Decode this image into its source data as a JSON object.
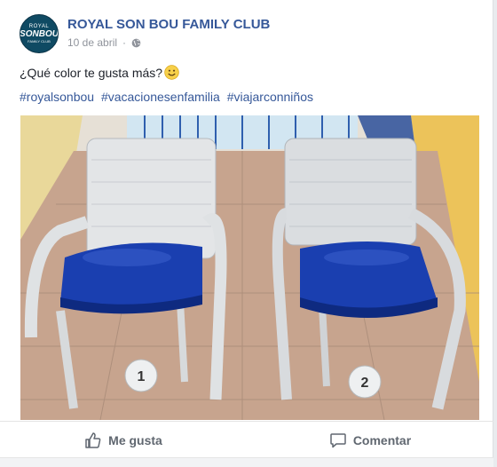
{
  "post": {
    "page_name": "ROYAL SON BOU FAMILY CLUB",
    "avatar_text": {
      "top": "ROYAL",
      "middle": "SONBOU",
      "bottom": "FAMILY CLUB"
    },
    "date": "10 de abril",
    "separator": "·",
    "privacy_icon": "globe-icon",
    "message": "¿Qué color te gusta más?",
    "emoji": "smile-emoji",
    "hashtags": [
      "#royalsonbou",
      "#vacacionesenfamilia",
      "#viajarconniños"
    ],
    "photo": {
      "labels": [
        "1",
        "2"
      ]
    }
  },
  "actions": {
    "like_label": "Me gusta",
    "comment_label": "Comentar"
  },
  "colors": {
    "link": "#365899",
    "muted": "#90949c",
    "seat_blue": "#1a3fb0",
    "wicker": "#d9dcdf"
  }
}
